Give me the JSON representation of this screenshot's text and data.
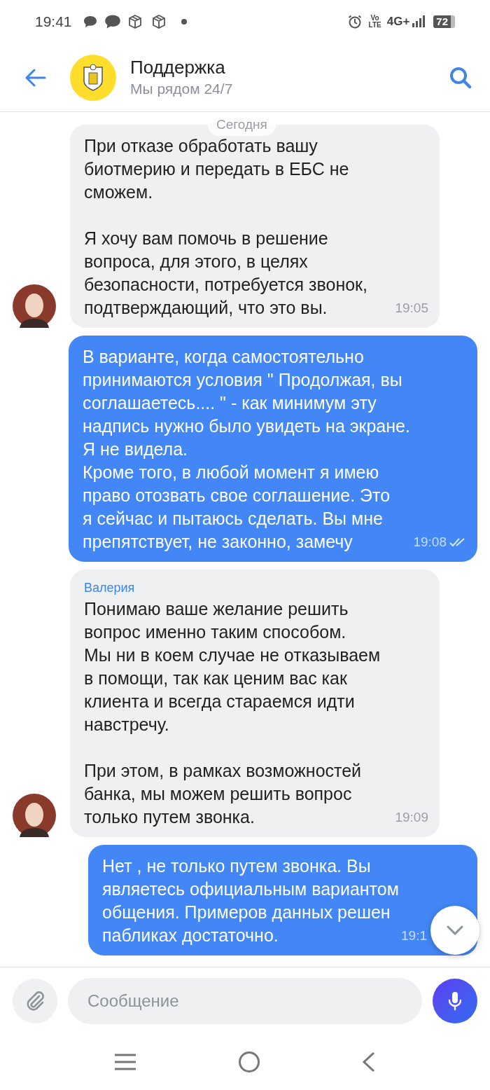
{
  "status_bar": {
    "time": "19:41",
    "volte": "Vo\nLTE",
    "network": "4G+",
    "battery": "72"
  },
  "header": {
    "title": "Поддержка",
    "subtitle": "Мы рядом 24/7"
  },
  "date_divider": "Сегодня",
  "messages": [
    {
      "kind": "incoming",
      "avatar": true,
      "text": "При отказе обработать вашу\nбиотмерию и передать в ЕБС не\nсможем.\n\nЯ хочу вам помочь в решение\nвопроса, для этого, в целях\nбезопасности, потребуется звонок,\nподтверждающий, что это вы.",
      "time": "19:05"
    },
    {
      "kind": "outgoing",
      "read": true,
      "text": "В варианте, когда самостоятельно\nпринимаются условия \" Продолжая, вы\nсоглашаетесь.... \" - как минимум эту\nнадпись нужно было увидеть на экране.\nЯ не видела.\nКроме того, в любой момент я имею\nправо отозвать свое соглашение. Это\nя сейчас и пытаюсь сделать. Вы мне\nпрепятствует, не законно, замечу",
      "time": "19:08"
    },
    {
      "kind": "incoming",
      "avatar": true,
      "sender": "Валерия",
      "text": "Понимаю ваше желание решить\nвопрос именно таким способом.\nМы ни в коем случае не отказываем\nв помощи, так как ценим вас как\nклиента и всегда стараемся идти\nнавстречу.\n\nПри этом, в рамках возможностей\nбанка, мы можем решить вопрос\nтолько путем звонка.",
      "time": "19:09"
    },
    {
      "kind": "outgoing",
      "read": false,
      "text": "Нет , не только путем звонка. Вы\nявляетесь официальным вариантом\nобщения. Примеров данных решен\nпабликах достаточно.",
      "time": "19:1"
    }
  ],
  "composer": {
    "placeholder": "Сообщение"
  }
}
